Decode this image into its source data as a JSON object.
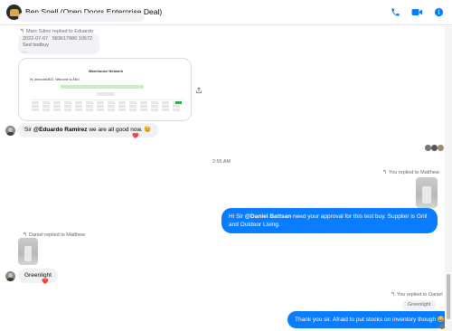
{
  "header": {
    "title": "Ben Snell (Open Doors Enterprise Deal)",
    "icons": [
      "phone-icon",
      "video-icon",
      "info-icon"
    ],
    "accent": "#0a7cff"
  },
  "messages": {
    "reply_meta_1": "Marc Silmo replied to Eduardo",
    "quoted_date": "2022-07-07",
    "quoted_number": "583617980 10572",
    "quoted_text": "Sed testbuy",
    "quoted_more": "...",
    "card": {
      "title": "Warehouse Network",
      "greeting": "Hi, amrocks0622. Welcome to ANO."
    },
    "msg_sir": {
      "prefix": "Sir ",
      "mention": "@Eduardo Ramirez",
      "suffix": " we are all good now. ",
      "emoji": "😉",
      "reaction": "❤️"
    },
    "timestamp": "2:55 AM",
    "reply_meta_2": "You replied to Matthew",
    "msg_out_1": {
      "prefix": "Hi Sir ",
      "mention": "@Daniel Battsan",
      "suffix": " need your approval for this test buy. Supplier is Grill and Outdoor Living."
    },
    "reply_meta_3": "Daniel replied to Matthew",
    "msg_green": {
      "text": "Greenlight",
      "reaction": "❤️"
    },
    "reply_meta_4": "You replied to Daniel",
    "quoted_green": "Greenlight",
    "msg_out_2": {
      "text": "Thank you sir. Afraid to put stocks on inventory though ",
      "emoji": "😅"
    },
    "reply_glyph": "↰"
  }
}
